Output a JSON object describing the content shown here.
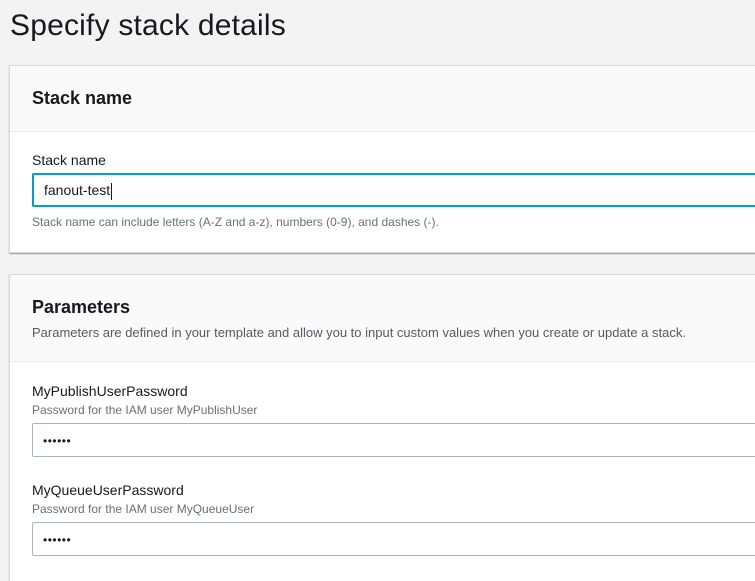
{
  "page": {
    "title": "Specify stack details"
  },
  "stack_name_panel": {
    "title": "Stack name",
    "field_label": "Stack name",
    "field_value": "fanout-test",
    "field_hint": "Stack name can include letters (A-Z and a-z), numbers (0-9), and dashes (-)."
  },
  "parameters_panel": {
    "title": "Parameters",
    "description": "Parameters are defined in your template and allow you to input custom values when you create or update a stack.",
    "params": [
      {
        "label": "MyPublishUserPassword",
        "description": "Password for the IAM user MyPublishUser",
        "masked_value": "••••••"
      },
      {
        "label": "MyQueueUserPassword",
        "description": "Password for the IAM user MyQueueUser",
        "masked_value": "••••••"
      }
    ]
  },
  "colors": {
    "focus_border": "#00a1c9",
    "background": "#f2f3f3",
    "panel_header": "#fafafa"
  }
}
